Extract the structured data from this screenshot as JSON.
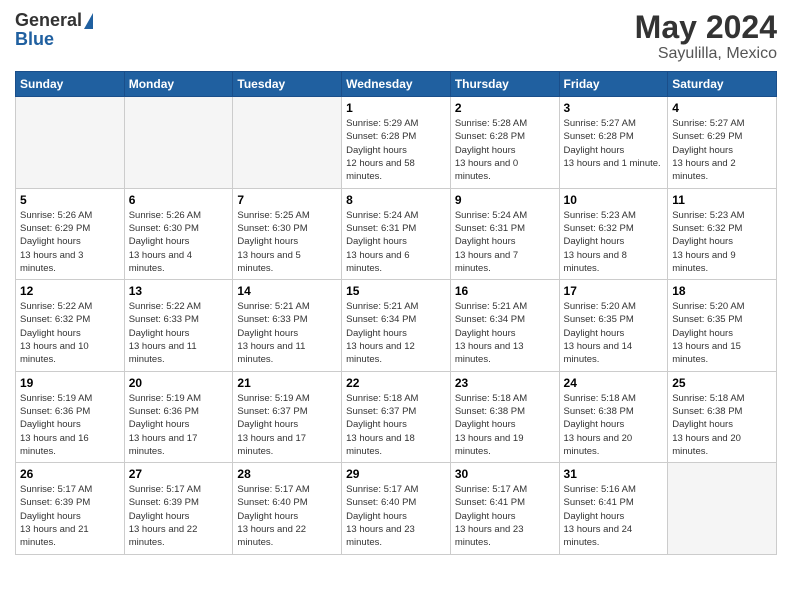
{
  "header": {
    "logo_general": "General",
    "logo_blue": "Blue",
    "title": "May 2024",
    "subtitle": "Sayulilla, Mexico"
  },
  "weekdays": [
    "Sunday",
    "Monday",
    "Tuesday",
    "Wednesday",
    "Thursday",
    "Friday",
    "Saturday"
  ],
  "weeks": [
    [
      {
        "day": "",
        "empty": true
      },
      {
        "day": "",
        "empty": true
      },
      {
        "day": "",
        "empty": true
      },
      {
        "day": "1",
        "sunrise": "5:29 AM",
        "sunset": "6:28 PM",
        "daylight": "12 hours and 58 minutes."
      },
      {
        "day": "2",
        "sunrise": "5:28 AM",
        "sunset": "6:28 PM",
        "daylight": "13 hours and 0 minutes."
      },
      {
        "day": "3",
        "sunrise": "5:27 AM",
        "sunset": "6:28 PM",
        "daylight": "13 hours and 1 minute."
      },
      {
        "day": "4",
        "sunrise": "5:27 AM",
        "sunset": "6:29 PM",
        "daylight": "13 hours and 2 minutes."
      }
    ],
    [
      {
        "day": "5",
        "sunrise": "5:26 AM",
        "sunset": "6:29 PM",
        "daylight": "13 hours and 3 minutes."
      },
      {
        "day": "6",
        "sunrise": "5:26 AM",
        "sunset": "6:30 PM",
        "daylight": "13 hours and 4 minutes."
      },
      {
        "day": "7",
        "sunrise": "5:25 AM",
        "sunset": "6:30 PM",
        "daylight": "13 hours and 5 minutes."
      },
      {
        "day": "8",
        "sunrise": "5:24 AM",
        "sunset": "6:31 PM",
        "daylight": "13 hours and 6 minutes."
      },
      {
        "day": "9",
        "sunrise": "5:24 AM",
        "sunset": "6:31 PM",
        "daylight": "13 hours and 7 minutes."
      },
      {
        "day": "10",
        "sunrise": "5:23 AM",
        "sunset": "6:32 PM",
        "daylight": "13 hours and 8 minutes."
      },
      {
        "day": "11",
        "sunrise": "5:23 AM",
        "sunset": "6:32 PM",
        "daylight": "13 hours and 9 minutes."
      }
    ],
    [
      {
        "day": "12",
        "sunrise": "5:22 AM",
        "sunset": "6:32 PM",
        "daylight": "13 hours and 10 minutes."
      },
      {
        "day": "13",
        "sunrise": "5:22 AM",
        "sunset": "6:33 PM",
        "daylight": "13 hours and 11 minutes."
      },
      {
        "day": "14",
        "sunrise": "5:21 AM",
        "sunset": "6:33 PM",
        "daylight": "13 hours and 11 minutes."
      },
      {
        "day": "15",
        "sunrise": "5:21 AM",
        "sunset": "6:34 PM",
        "daylight": "13 hours and 12 minutes."
      },
      {
        "day": "16",
        "sunrise": "5:21 AM",
        "sunset": "6:34 PM",
        "daylight": "13 hours and 13 minutes."
      },
      {
        "day": "17",
        "sunrise": "5:20 AM",
        "sunset": "6:35 PM",
        "daylight": "13 hours and 14 minutes."
      },
      {
        "day": "18",
        "sunrise": "5:20 AM",
        "sunset": "6:35 PM",
        "daylight": "13 hours and 15 minutes."
      }
    ],
    [
      {
        "day": "19",
        "sunrise": "5:19 AM",
        "sunset": "6:36 PM",
        "daylight": "13 hours and 16 minutes."
      },
      {
        "day": "20",
        "sunrise": "5:19 AM",
        "sunset": "6:36 PM",
        "daylight": "13 hours and 17 minutes."
      },
      {
        "day": "21",
        "sunrise": "5:19 AM",
        "sunset": "6:37 PM",
        "daylight": "13 hours and 17 minutes."
      },
      {
        "day": "22",
        "sunrise": "5:18 AM",
        "sunset": "6:37 PM",
        "daylight": "13 hours and 18 minutes."
      },
      {
        "day": "23",
        "sunrise": "5:18 AM",
        "sunset": "6:38 PM",
        "daylight": "13 hours and 19 minutes."
      },
      {
        "day": "24",
        "sunrise": "5:18 AM",
        "sunset": "6:38 PM",
        "daylight": "13 hours and 20 minutes."
      },
      {
        "day": "25",
        "sunrise": "5:18 AM",
        "sunset": "6:38 PM",
        "daylight": "13 hours and 20 minutes."
      }
    ],
    [
      {
        "day": "26",
        "sunrise": "5:17 AM",
        "sunset": "6:39 PM",
        "daylight": "13 hours and 21 minutes."
      },
      {
        "day": "27",
        "sunrise": "5:17 AM",
        "sunset": "6:39 PM",
        "daylight": "13 hours and 22 minutes."
      },
      {
        "day": "28",
        "sunrise": "5:17 AM",
        "sunset": "6:40 PM",
        "daylight": "13 hours and 22 minutes."
      },
      {
        "day": "29",
        "sunrise": "5:17 AM",
        "sunset": "6:40 PM",
        "daylight": "13 hours and 23 minutes."
      },
      {
        "day": "30",
        "sunrise": "5:17 AM",
        "sunset": "6:41 PM",
        "daylight": "13 hours and 23 minutes."
      },
      {
        "day": "31",
        "sunrise": "5:16 AM",
        "sunset": "6:41 PM",
        "daylight": "13 hours and 24 minutes."
      },
      {
        "day": "",
        "empty": true
      }
    ]
  ],
  "labels": {
    "sunrise": "Sunrise:",
    "sunset": "Sunset:",
    "daylight": "Daylight hours"
  }
}
